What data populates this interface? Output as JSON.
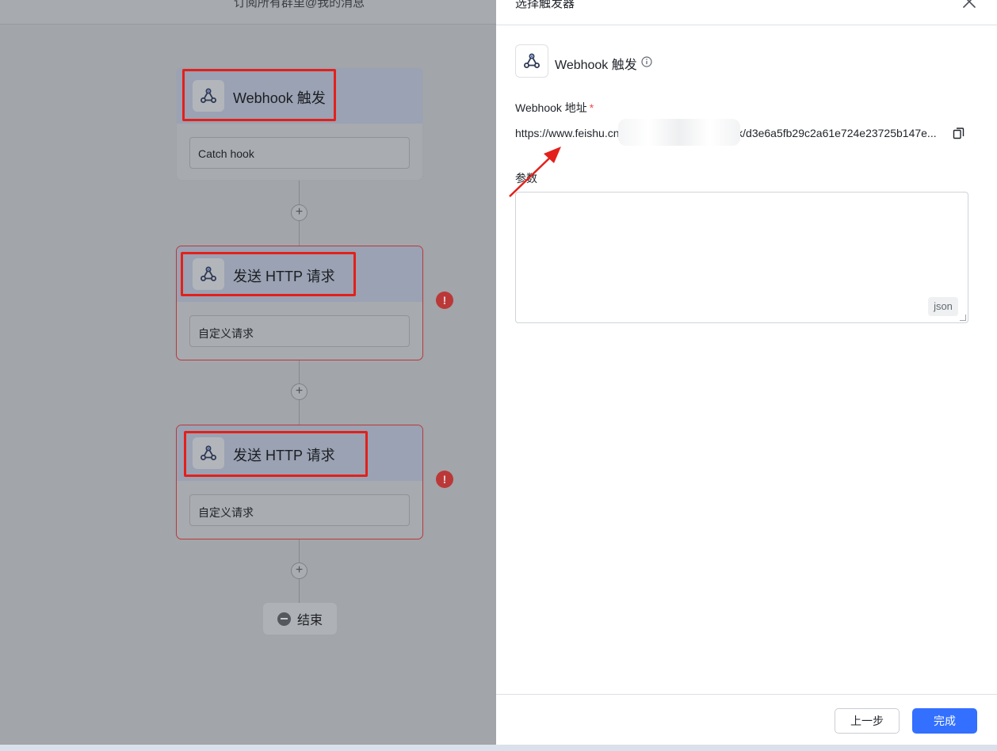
{
  "canvas": {
    "title": "订阅所有群里@我的消息",
    "nodes": [
      {
        "title": "Webhook 触发",
        "field": "Catch hook",
        "error": false
      },
      {
        "title": "发送 HTTP 请求",
        "field": "自定义请求",
        "error": true
      },
      {
        "title": "发送 HTTP 请求",
        "field": "自定义请求",
        "error": true
      }
    ],
    "plus_symbol": "+",
    "error_symbol": "!",
    "end_label": "结束"
  },
  "drawer": {
    "title": "选择触发器",
    "trigger_name": "Webhook 触发",
    "url_label": "Webhook 地址",
    "required_mark": "*",
    "url_value": "https://www.feishu.cn/flow/api/trigger-webhook/d3e6a5fb29c2a61e724e23725b147e...",
    "params_label": "参数",
    "params_value": "",
    "json_tag": "json",
    "prev_button": "上一步",
    "done_button": "完成"
  },
  "icons": {
    "webhook": "webhook-icon",
    "close": "close-icon",
    "info": "info-icon",
    "copy": "copy-icon",
    "end": "minus-circle-icon"
  },
  "colors": {
    "primary": "#3370ff",
    "error": "#bb3838",
    "highlight": "#e3201b",
    "required": "#f54a45"
  }
}
